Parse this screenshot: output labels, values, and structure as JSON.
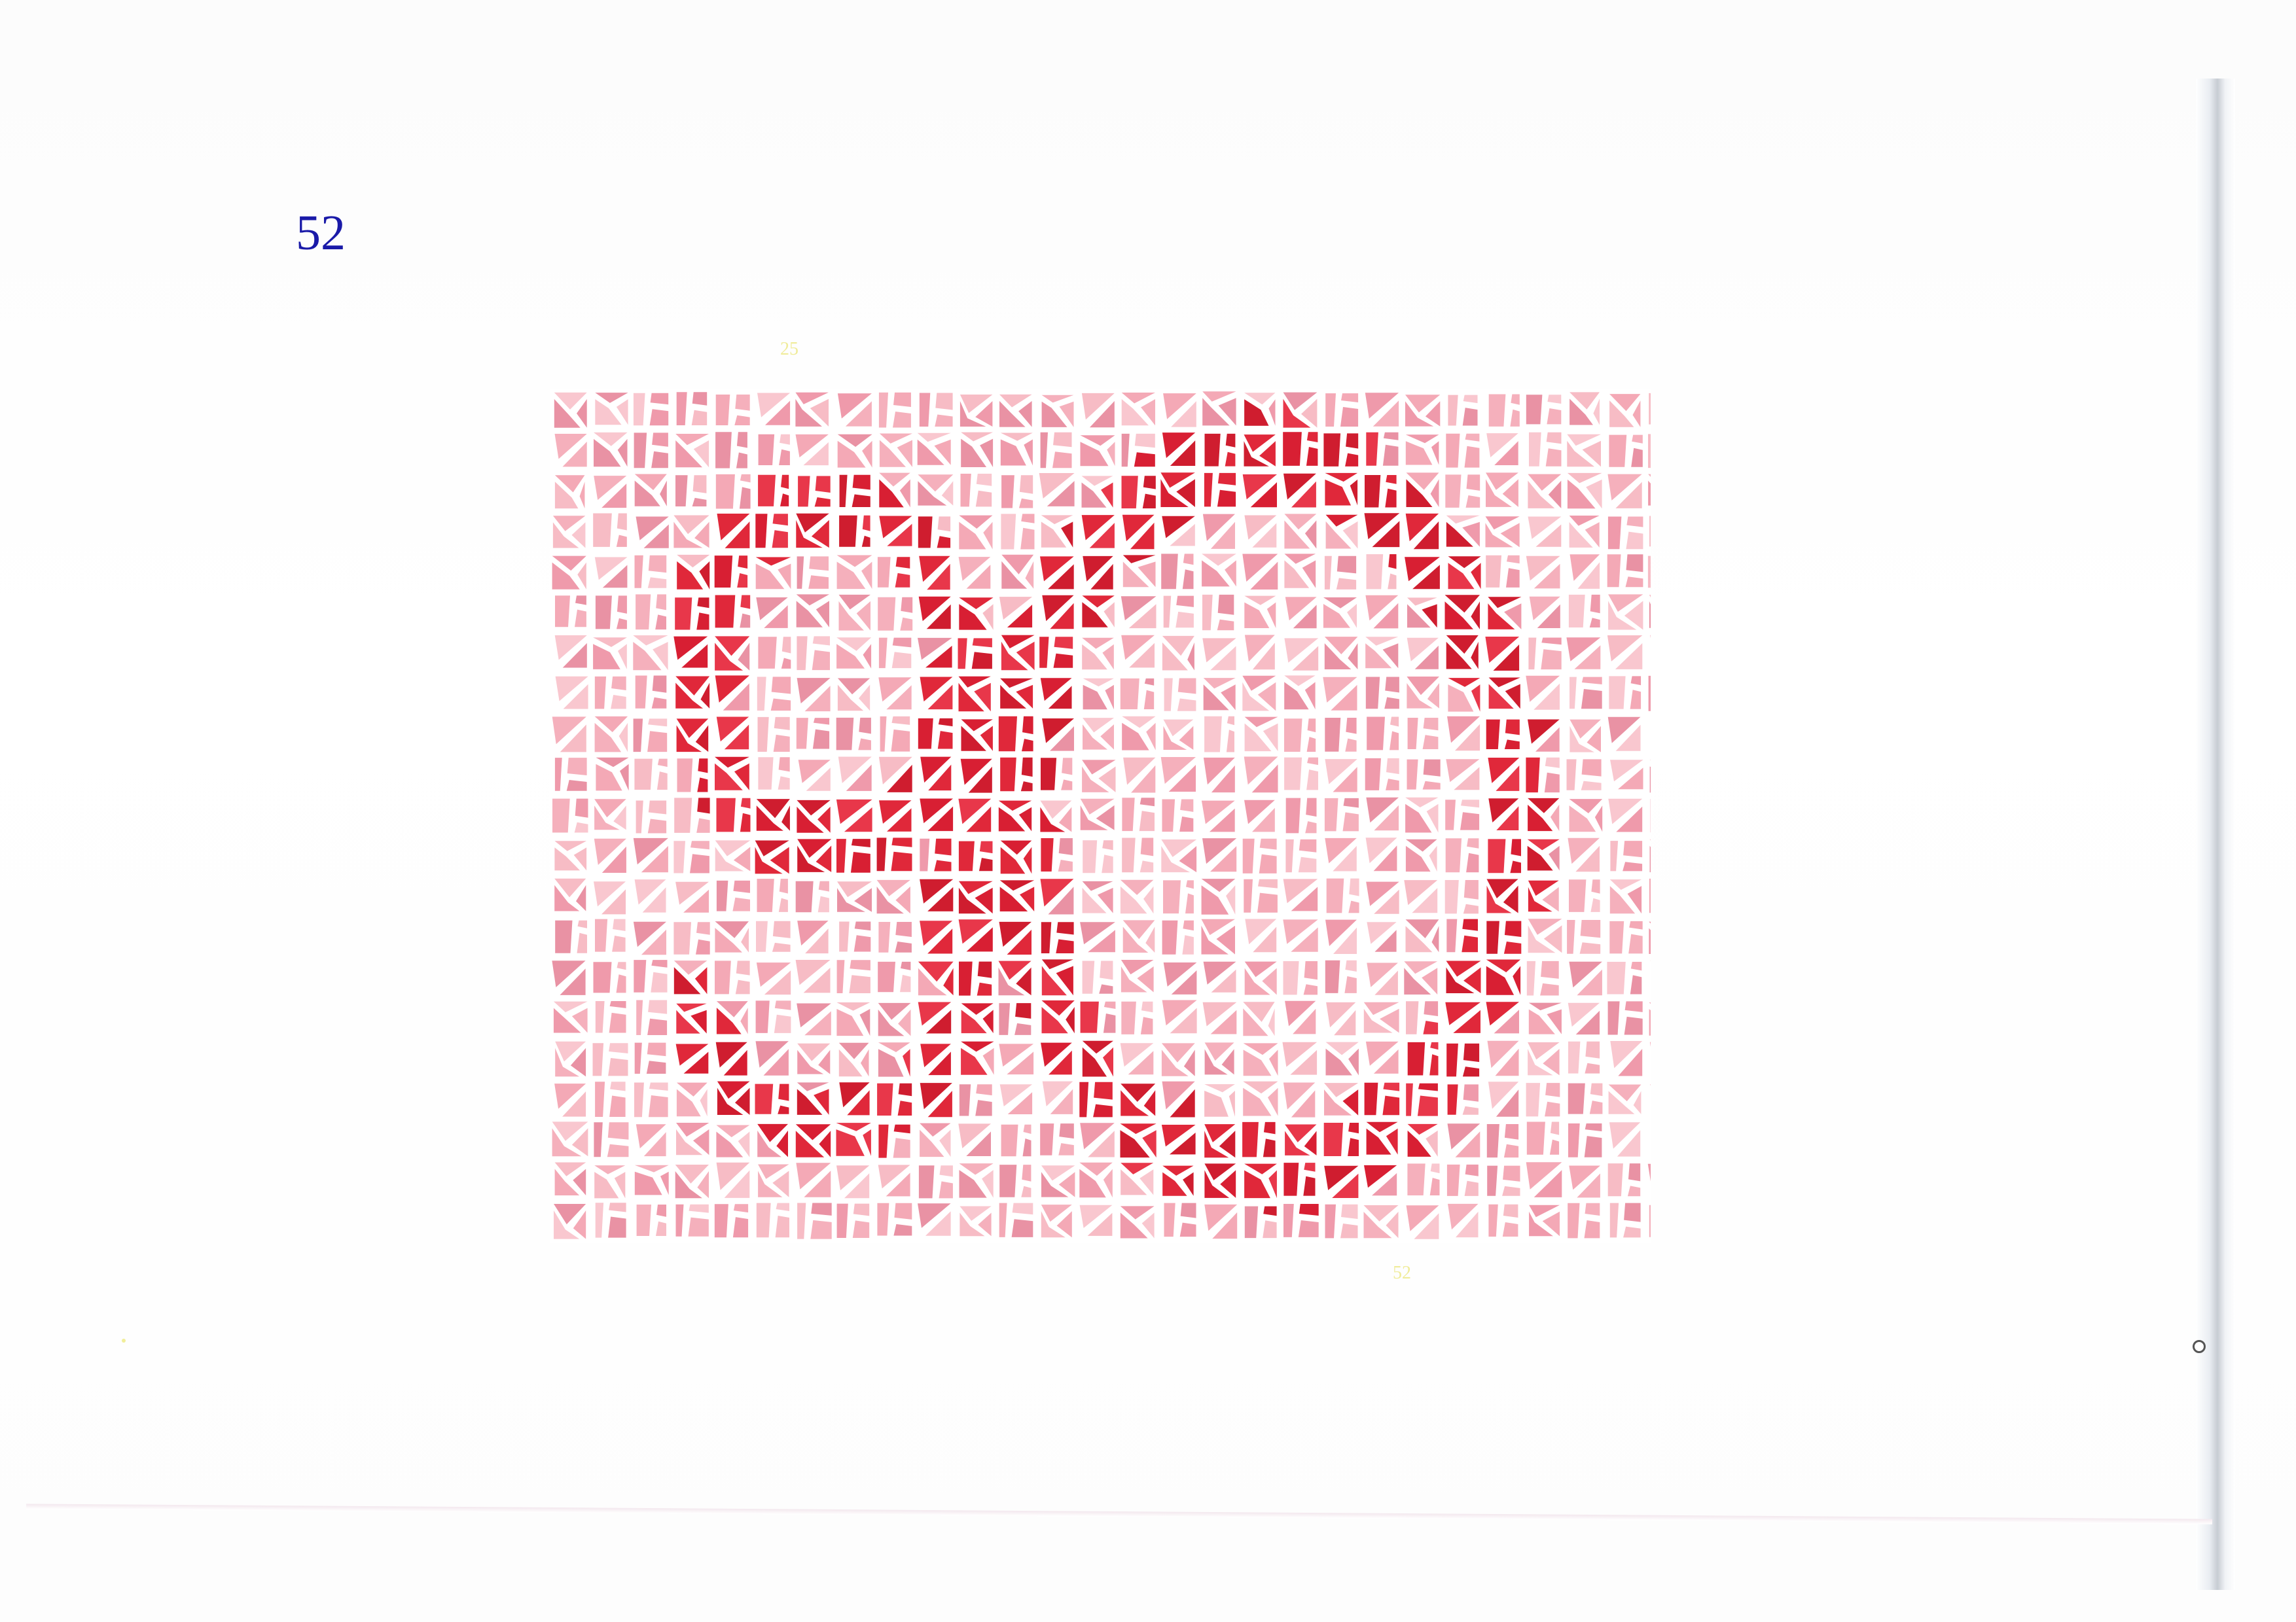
{
  "page": {
    "number": "52"
  },
  "plate": {
    "figure_digits": "90",
    "colors": {
      "background_tiles": [
        "#f4a9b6",
        "#f7bcc5",
        "#ef9aab",
        "#f5b0bc",
        "#e992a4",
        "#f9c7cf"
      ],
      "figure_tiles": [
        "#e0283a",
        "#d81f33",
        "#e8374a",
        "#cf1d2f"
      ],
      "grout": "#ffffff"
    }
  },
  "ghost_labels": {
    "top": "25",
    "bottom": "52"
  }
}
